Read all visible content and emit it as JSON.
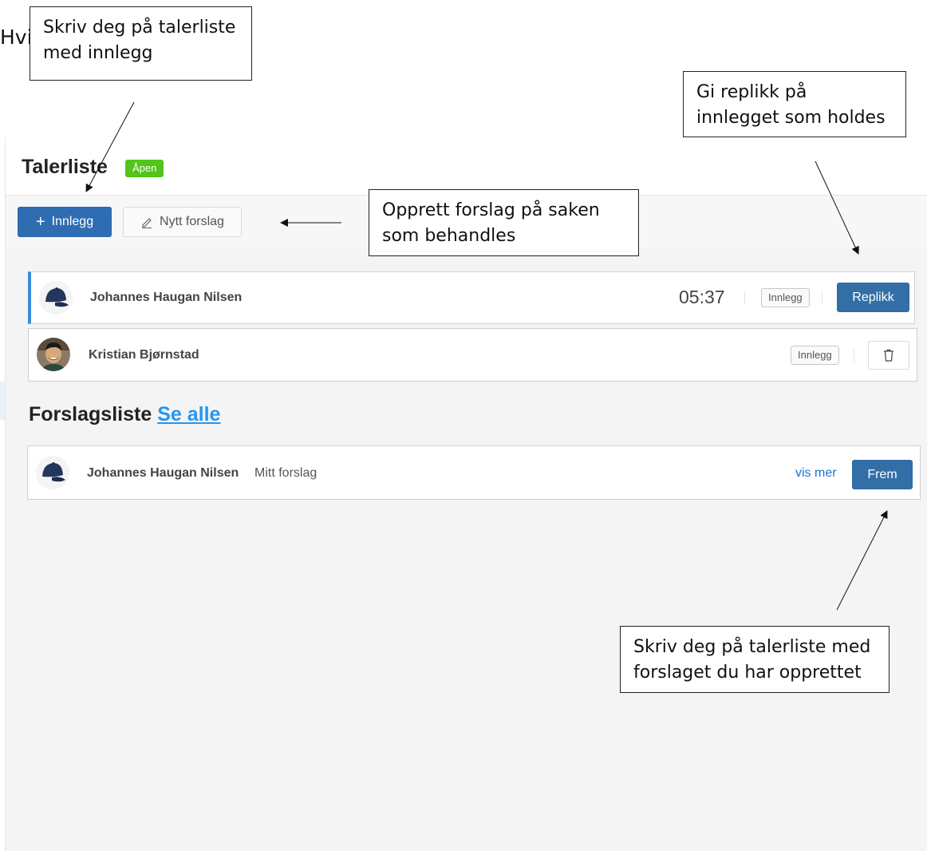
{
  "annotations": {
    "hvis": "Hvis",
    "callout_add_entry": "Skriv deg på talerliste\nmed innlegg",
    "callout_reply": "Gi replikk på\ninnlegget som holdes",
    "callout_proposal": "Opprett forslag på saken\nsom behandles",
    "callout_proposal_queue": "Skriv deg på talerliste med\nforslaget du har opprettet"
  },
  "header": {
    "title": "Talerliste",
    "status_badge": "Åpen"
  },
  "toolbar": {
    "add_entry_label": "Innlegg",
    "new_proposal_label": "Nytt forslag"
  },
  "speakers": [
    {
      "name": "Johannes Haugan Nilsen",
      "timer": "05:37",
      "tag": "Innlegg",
      "action": "Replikk",
      "active": true
    },
    {
      "name": "Kristian Bjørnstad",
      "tag": "Innlegg",
      "active": false
    }
  ],
  "proposals": {
    "title": "Forslagsliste",
    "see_all": "Se alle",
    "items": [
      {
        "name": "Johannes Haugan Nilsen",
        "text": "Mitt forslag",
        "more_link": "vis mer",
        "action": "Frem"
      }
    ]
  },
  "colors": {
    "primary": "#2f6db3",
    "badge_green": "#52c41a",
    "active_border": "#3b8cdf",
    "link_blue": "#2496f0"
  }
}
